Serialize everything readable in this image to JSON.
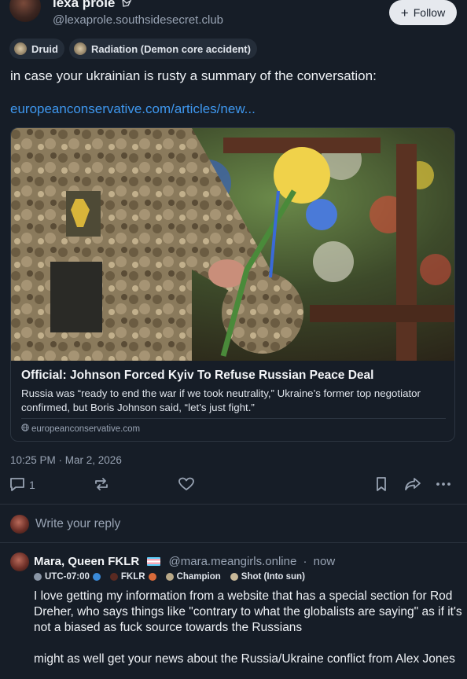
{
  "author": {
    "display_name": "lexa prole",
    "name_icon": "bird-icon",
    "handle": "@lexaprole.southsidesecret.club",
    "follow_label": "Follow",
    "badges": [
      {
        "label": "Druid",
        "icon": "druid-emblem-icon"
      },
      {
        "label": "Radiation (Demon core accident)",
        "icon": "radiation-emblem-icon"
      }
    ]
  },
  "post": {
    "text": "in case your ukrainian is rusty a summary of the conversation:",
    "link_text": "europeanconservative.com/articles/new...",
    "link_card": {
      "title": "Official: Johnson Forced Kyiv To Refuse Russian Peace Deal",
      "description": "Russia was “ready to end the war if we took neutrality,” Ukraine’s former top negotiator confirmed, but Boris Johnson said, “let’s just fight.”",
      "domain": "europeanconservative.com"
    },
    "timestamp": "10:25 PM · Mar 2, 2026",
    "reply_count": "1"
  },
  "reply_box": {
    "placeholder": "Write your reply"
  },
  "reply": {
    "display_name": "Mara, Queen FKLR",
    "handle": "@mara.meangirls.online",
    "time": "now",
    "badges": [
      {
        "label": "UTC-07:00",
        "icon": "globe-icon"
      },
      {
        "label": "FKLR",
        "icon": "fklr-icon"
      },
      {
        "label": "Champion",
        "icon": "champion-icon"
      },
      {
        "label": "Shot (Into sun)",
        "icon": "shot-icon"
      }
    ],
    "text": "I love getting my information from a website that has a special section for Rod Dreher, who says things like \"contrary to what the globalists are saying\" as if it's not a biased as fuck source towards the Russians\n\nmight as well get your news about the Russia/Ukraine conflict from Alex Jones"
  },
  "colors": {
    "background": "#161d27",
    "link": "#3e97ee",
    "muted": "#98a3b3",
    "follow_button": "#e6e9ee"
  }
}
